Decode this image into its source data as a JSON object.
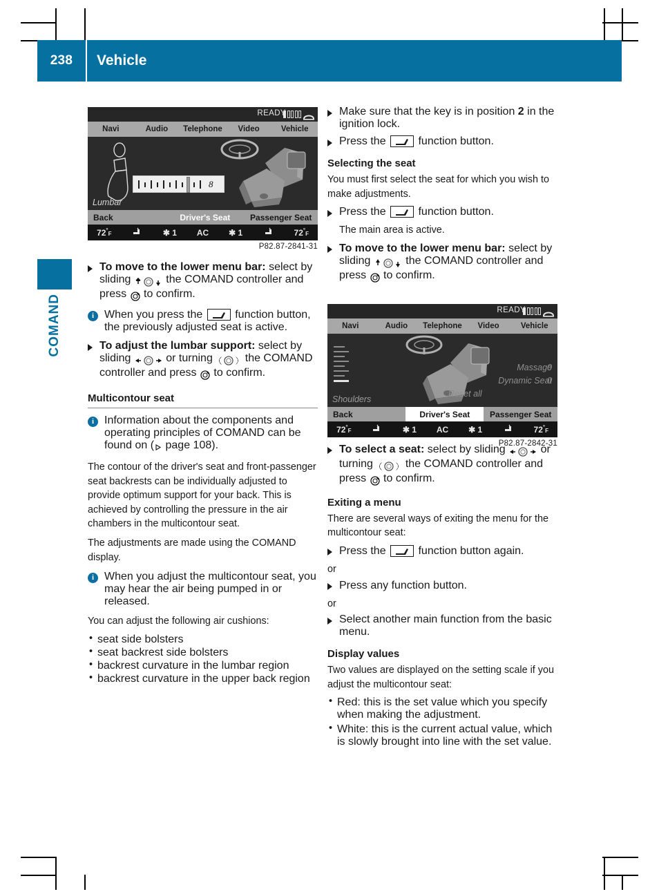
{
  "header": {
    "page_number": "238",
    "chapter": "Vehicle",
    "accent_color": "#0670a0"
  },
  "side_tab": {
    "label": "COMAND"
  },
  "display_1": {
    "status": {
      "ready": "READY",
      "signal_bars": 5,
      "signal_filled": 1,
      "phone_icon": "phone-handset-icon"
    },
    "menu": [
      "Navi",
      "Audio",
      "Telephone",
      "Video",
      "Vehicle"
    ],
    "main_label": "Lumbar",
    "scale_value": "8",
    "softkeys": [
      "Back",
      "Driver's Seat",
      "Passenger Seat"
    ],
    "climate": [
      "72",
      "seat-heating-icon",
      "1",
      "AC",
      "1",
      "seat-heating-icon",
      "72"
    ],
    "climate_left_temp": "72",
    "climate_right_temp": "72",
    "climate_center": "AC",
    "fan_left": "1",
    "fan_right": "1",
    "caption": "P82.87-2841-31"
  },
  "display_2": {
    "status": {
      "ready": "READY",
      "signal_bars": 5,
      "signal_filled": 1,
      "phone_icon": "phone-handset-icon"
    },
    "menu": [
      "Navi",
      "Audio",
      "Telephone",
      "Video",
      "Vehicle"
    ],
    "main_label": "Shoulders",
    "options": [
      {
        "label": "Massage",
        "value": "0"
      },
      {
        "label": "Dynamic Seat",
        "value": "0"
      },
      {
        "label": "Reset all",
        "value": ""
      }
    ],
    "softkeys": [
      "Back",
      "Driver's Seat",
      "Passenger Seat"
    ],
    "climate_left_temp": "72",
    "climate_right_temp": "72",
    "climate_center": "AC",
    "fan_left": "1",
    "fan_right": "1",
    "caption": "P82.87-2842-31"
  },
  "left_column": {
    "step_lower_menu_bar": {
      "bold": "To move to the lower menu bar:",
      "rest_1": " select by sliding ",
      "rest_2": " the COMAND controller and press ",
      "rest_3": " to confirm."
    },
    "note_function_button": {
      "text_1": "When you press the ",
      "text_2": " function button, the previously adjusted seat is active."
    },
    "step_lumbar_support": {
      "bold": "To adjust the lumbar support:",
      "rest_1": " select by sliding ",
      "rest_2": " or turning ",
      "rest_3": " the COMAND controller and press ",
      "rest_4": " to confirm."
    },
    "section_heading": "Multicontour seat",
    "note_comand_info": "Information about the components and operating principles of COMAND can be found on (",
    "note_comand_info_page": " page 108).",
    "para_contour": "The contour of the driver's seat and front-passenger seat backrests can be individually adjusted to provide optimum support for your back. This is achieved by controlling the pressure in the air chambers in the multicontour seat.",
    "para_adjustments": "The adjustments are made using the COMAND display.",
    "note_air_pump": "When you adjust the multicontour seat, you may hear the air being pumped in or released.",
    "para_cushions_intro": "You can adjust the following air cushions:",
    "cushion_list": [
      "seat side bolsters",
      "seat backrest side bolsters",
      "backrest curvature in the lumbar region",
      "backrest curvature in the upper back region"
    ]
  },
  "right_column": {
    "step_key_position": {
      "text_1": "Make sure that the key is in position ",
      "bold": "2",
      "text_2": " in the ignition lock."
    },
    "step_press_function": {
      "text_1": "Press the ",
      "text_2": " function button."
    },
    "heading_selecting_seat": "Selecting the seat",
    "para_select_seat": "You must first select the seat for which you wish to make adjustments.",
    "step_press_function_2": {
      "text_1": "Press the ",
      "text_2": " function button."
    },
    "para_main_area": "The main area is active.",
    "step_lower_menu_bar": {
      "bold": "To move to the lower menu bar:",
      "rest_1": " select by sliding ",
      "rest_2": " the COMAND controller and press ",
      "rest_3": " to confirm."
    },
    "step_select_seat": {
      "bold": "To select a seat:",
      "rest_1": " select by sliding ",
      "rest_2": " or turning ",
      "rest_3": " the COMAND controller and press ",
      "rest_4": " to confirm."
    },
    "heading_exiting_menu": "Exiting a menu",
    "para_exiting": "There are several ways of exiting the menu for the multicontour seat:",
    "step_press_again": {
      "text_1": "Press the ",
      "text_2": " function button again."
    },
    "or_1": "or",
    "step_press_any": "Press any function button.",
    "or_2": "or",
    "step_select_other": "Select another main function from the basic menu.",
    "heading_display_values": "Display values",
    "para_display_values": "Two values are displayed on the setting scale if you adjust the multicontour seat:",
    "value_list": [
      "Red: this is the set value which you specify when making the adjustment.",
      "White: this is the current actual value, which is slowly brought into line with the set value."
    ]
  }
}
